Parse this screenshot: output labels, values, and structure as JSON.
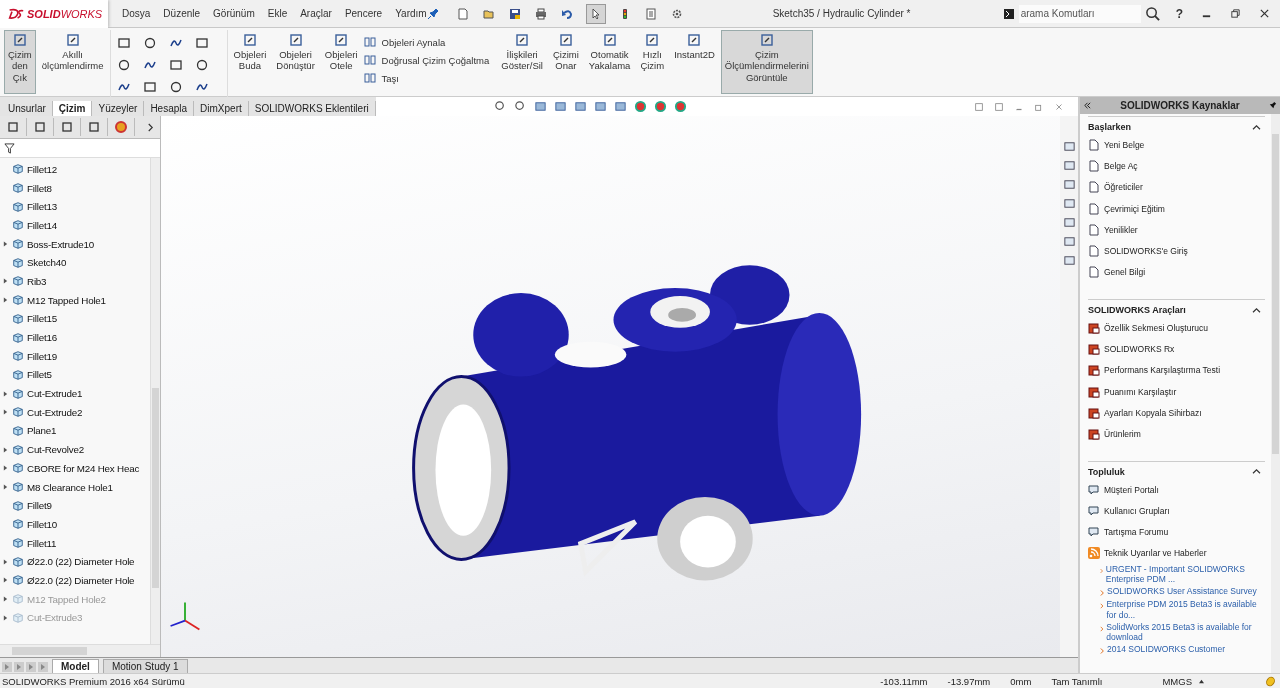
{
  "logo": "**SOLID**WORKS",
  "menu": [
    "Dosya",
    "Düzenle",
    "Görünüm",
    "Ekle",
    "Araçlar",
    "Pencere",
    "Yardım"
  ],
  "title": "Sketch35 / Hydraulic Cylinder *",
  "search": {
    "placeholder": "arama Komutları"
  },
  "help": "?",
  "ribbon": [
    {
      "kind": "large",
      "label": "Çizim den Çık",
      "selected": true
    },
    {
      "kind": "large",
      "label": "Akıllı ölçümlendirme",
      "selected": false
    },
    {
      "kind": "tools"
    },
    {
      "kind": "large",
      "label": "Objeleri Buda",
      "selected": false
    },
    {
      "kind": "large",
      "label": "Objeleri Dönüştür",
      "selected": false
    },
    {
      "kind": "large",
      "label": "Objeleri Otele",
      "selected": false
    },
    {
      "kind": "stack",
      "items": [
        "Objeleri Aynala",
        "Doğrusal Çizim Çoğaltma",
        "Taşı"
      ]
    },
    {
      "kind": "large",
      "label": "İlişkileri Göster/Sil",
      "selected": false
    },
    {
      "kind": "large",
      "label": "Çizimi Onar",
      "selected": false
    },
    {
      "kind": "large",
      "label": "Otomatik Yakalama",
      "selected": false
    },
    {
      "kind": "large",
      "label": "Hızlı Çizim",
      "selected": false
    },
    {
      "kind": "large",
      "label": "Instant2D",
      "selected": false
    },
    {
      "kind": "large",
      "label": "Çizim Ölçümlendirmelerini Görüntüle",
      "selected": true
    }
  ],
  "command_tabs": [
    {
      "label": "Unsurlar",
      "selected": false
    },
    {
      "label": "Çizim",
      "selected": true
    },
    {
      "label": "Yüzeyler",
      "selected": false
    },
    {
      "label": "Hesapla",
      "selected": false
    },
    {
      "label": "DimXpert",
      "selected": false
    },
    {
      "label": "SOLIDWORKS Eklentileri",
      "selected": false
    }
  ],
  "tree": [
    {
      "label": "Fillet12",
      "expandable": false,
      "disabled": false
    },
    {
      "label": "Fillet8",
      "expandable": false,
      "disabled": false
    },
    {
      "label": "Fillet13",
      "expandable": false,
      "disabled": false
    },
    {
      "label": "Fillet14",
      "expandable": false,
      "disabled": false
    },
    {
      "label": "Boss-Extrude10",
      "expandable": true,
      "disabled": false
    },
    {
      "label": "Sketch40",
      "expandable": false,
      "disabled": false
    },
    {
      "label": "Rib3",
      "expandable": true,
      "disabled": false
    },
    {
      "label": "M12 Tapped Hole1",
      "expandable": true,
      "disabled": false
    },
    {
      "label": "Fillet15",
      "expandable": false,
      "disabled": false
    },
    {
      "label": "Fillet16",
      "expandable": false,
      "disabled": false
    },
    {
      "label": "Fillet19",
      "expandable": false,
      "disabled": false
    },
    {
      "label": "Fillet5",
      "expandable": false,
      "disabled": false
    },
    {
      "label": "Cut-Extrude1",
      "expandable": true,
      "disabled": false
    },
    {
      "label": "Cut-Extrude2",
      "expandable": true,
      "disabled": false
    },
    {
      "label": "Plane1",
      "expandable": false,
      "disabled": false
    },
    {
      "label": "Cut-Revolve2",
      "expandable": true,
      "disabled": false
    },
    {
      "label": "CBORE for M24 Hex Heac",
      "expandable": true,
      "disabled": false
    },
    {
      "label": "M8 Clearance Hole1",
      "expandable": true,
      "disabled": false
    },
    {
      "label": "Fillet9",
      "expandable": false,
      "disabled": false
    },
    {
      "label": "Fillet10",
      "expandable": false,
      "disabled": false
    },
    {
      "label": "Fillet11",
      "expandable": false,
      "disabled": false
    },
    {
      "label": "Ø22.0 (22) Diameter Hole",
      "expandable": true,
      "disabled": false
    },
    {
      "label": "Ø22.0 (22) Diameter Hole",
      "expandable": true,
      "disabled": false
    },
    {
      "label": "M12 Tapped Hole2",
      "expandable": true,
      "disabled": true
    },
    {
      "label": "Cut-Extrude3",
      "expandable": true,
      "disabled": true
    }
  ],
  "view_tabs": [
    {
      "label": "Model",
      "selected": true
    },
    {
      "label": "Motion Study 1",
      "selected": false
    }
  ],
  "resources": {
    "title": "SOLIDWORKS Kaynaklar",
    "sections": [
      {
        "title": "Başlarken",
        "expanded": true,
        "items": [
          "Yeni Belge",
          "Belge Aç",
          "Öğreticiler",
          "Çevrimiçi Eğitim",
          "Yenilikler",
          "SOLIDWORKS'e Giriş",
          "Genel Bilgi"
        ]
      },
      {
        "title": "SOLIDWORKS Araçları",
        "expanded": true,
        "items": [
          "Özellik Sekmesi Oluşturucu",
          "SOLIDWORKS Rx",
          "Performans Karşılaştırma Testi",
          "Puanımı Karşılaştır",
          "Ayarları Kopyala Sihirbazı",
          "Ürünlerim"
        ]
      },
      {
        "title": "Topluluk",
        "expanded": true,
        "items": [
          "Müşteri Portalı",
          "Kullanıcı Grupları",
          "Tartışma Forumu"
        ],
        "feed": {
          "title": "Teknik Uyarılar ve Haberler",
          "links": [
            "URGENT - Important SOLIDWORKS Enterprise PDM ...",
            "SOLIDWORKS User Assistance Survey",
            "Enterprise PDM 2015 Beta3 is available for do...",
            "SolidWorks 2015 Beta3 is available for download",
            "2014 SOLIDWORKS Customer"
          ]
        }
      }
    ]
  },
  "status": {
    "product": "SOLIDWORKS Premium 2016 x64 Sürümü",
    "x": "-103.11mm",
    "y": "-13.97mm",
    "z": "0mm",
    "state": "Tam Tanımlı",
    "units": "MMGS"
  }
}
